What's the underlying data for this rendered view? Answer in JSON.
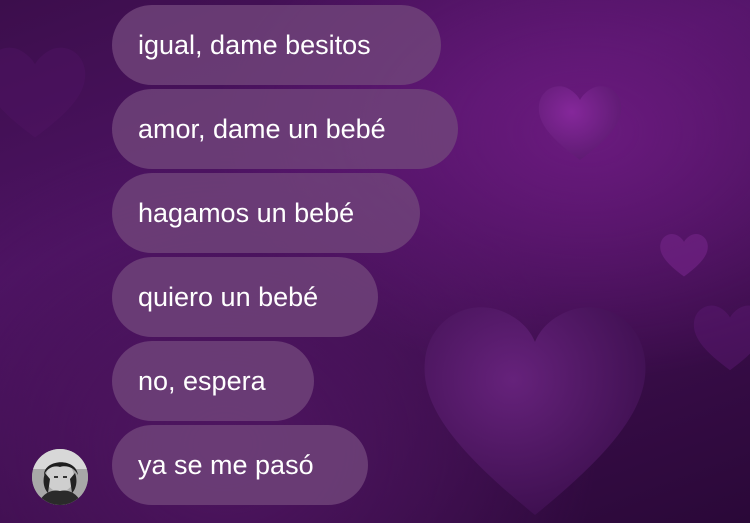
{
  "colors": {
    "background_dark": "#3a0d4a",
    "background_mid": "#4d1363",
    "heart_color": "#6f2384",
    "bubble_color": "#70447a",
    "text_color": "#ffffff"
  },
  "chat": {
    "messages": [
      {
        "text": "igual, dame besitos"
      },
      {
        "text": "amor, dame un bebé"
      },
      {
        "text": "hagamos un bebé"
      },
      {
        "text": "quiero un bebé"
      },
      {
        "text": "no, espera"
      },
      {
        "text": "ya se me pasó"
      }
    ],
    "sender_avatar_icon": "user-avatar-icon"
  }
}
